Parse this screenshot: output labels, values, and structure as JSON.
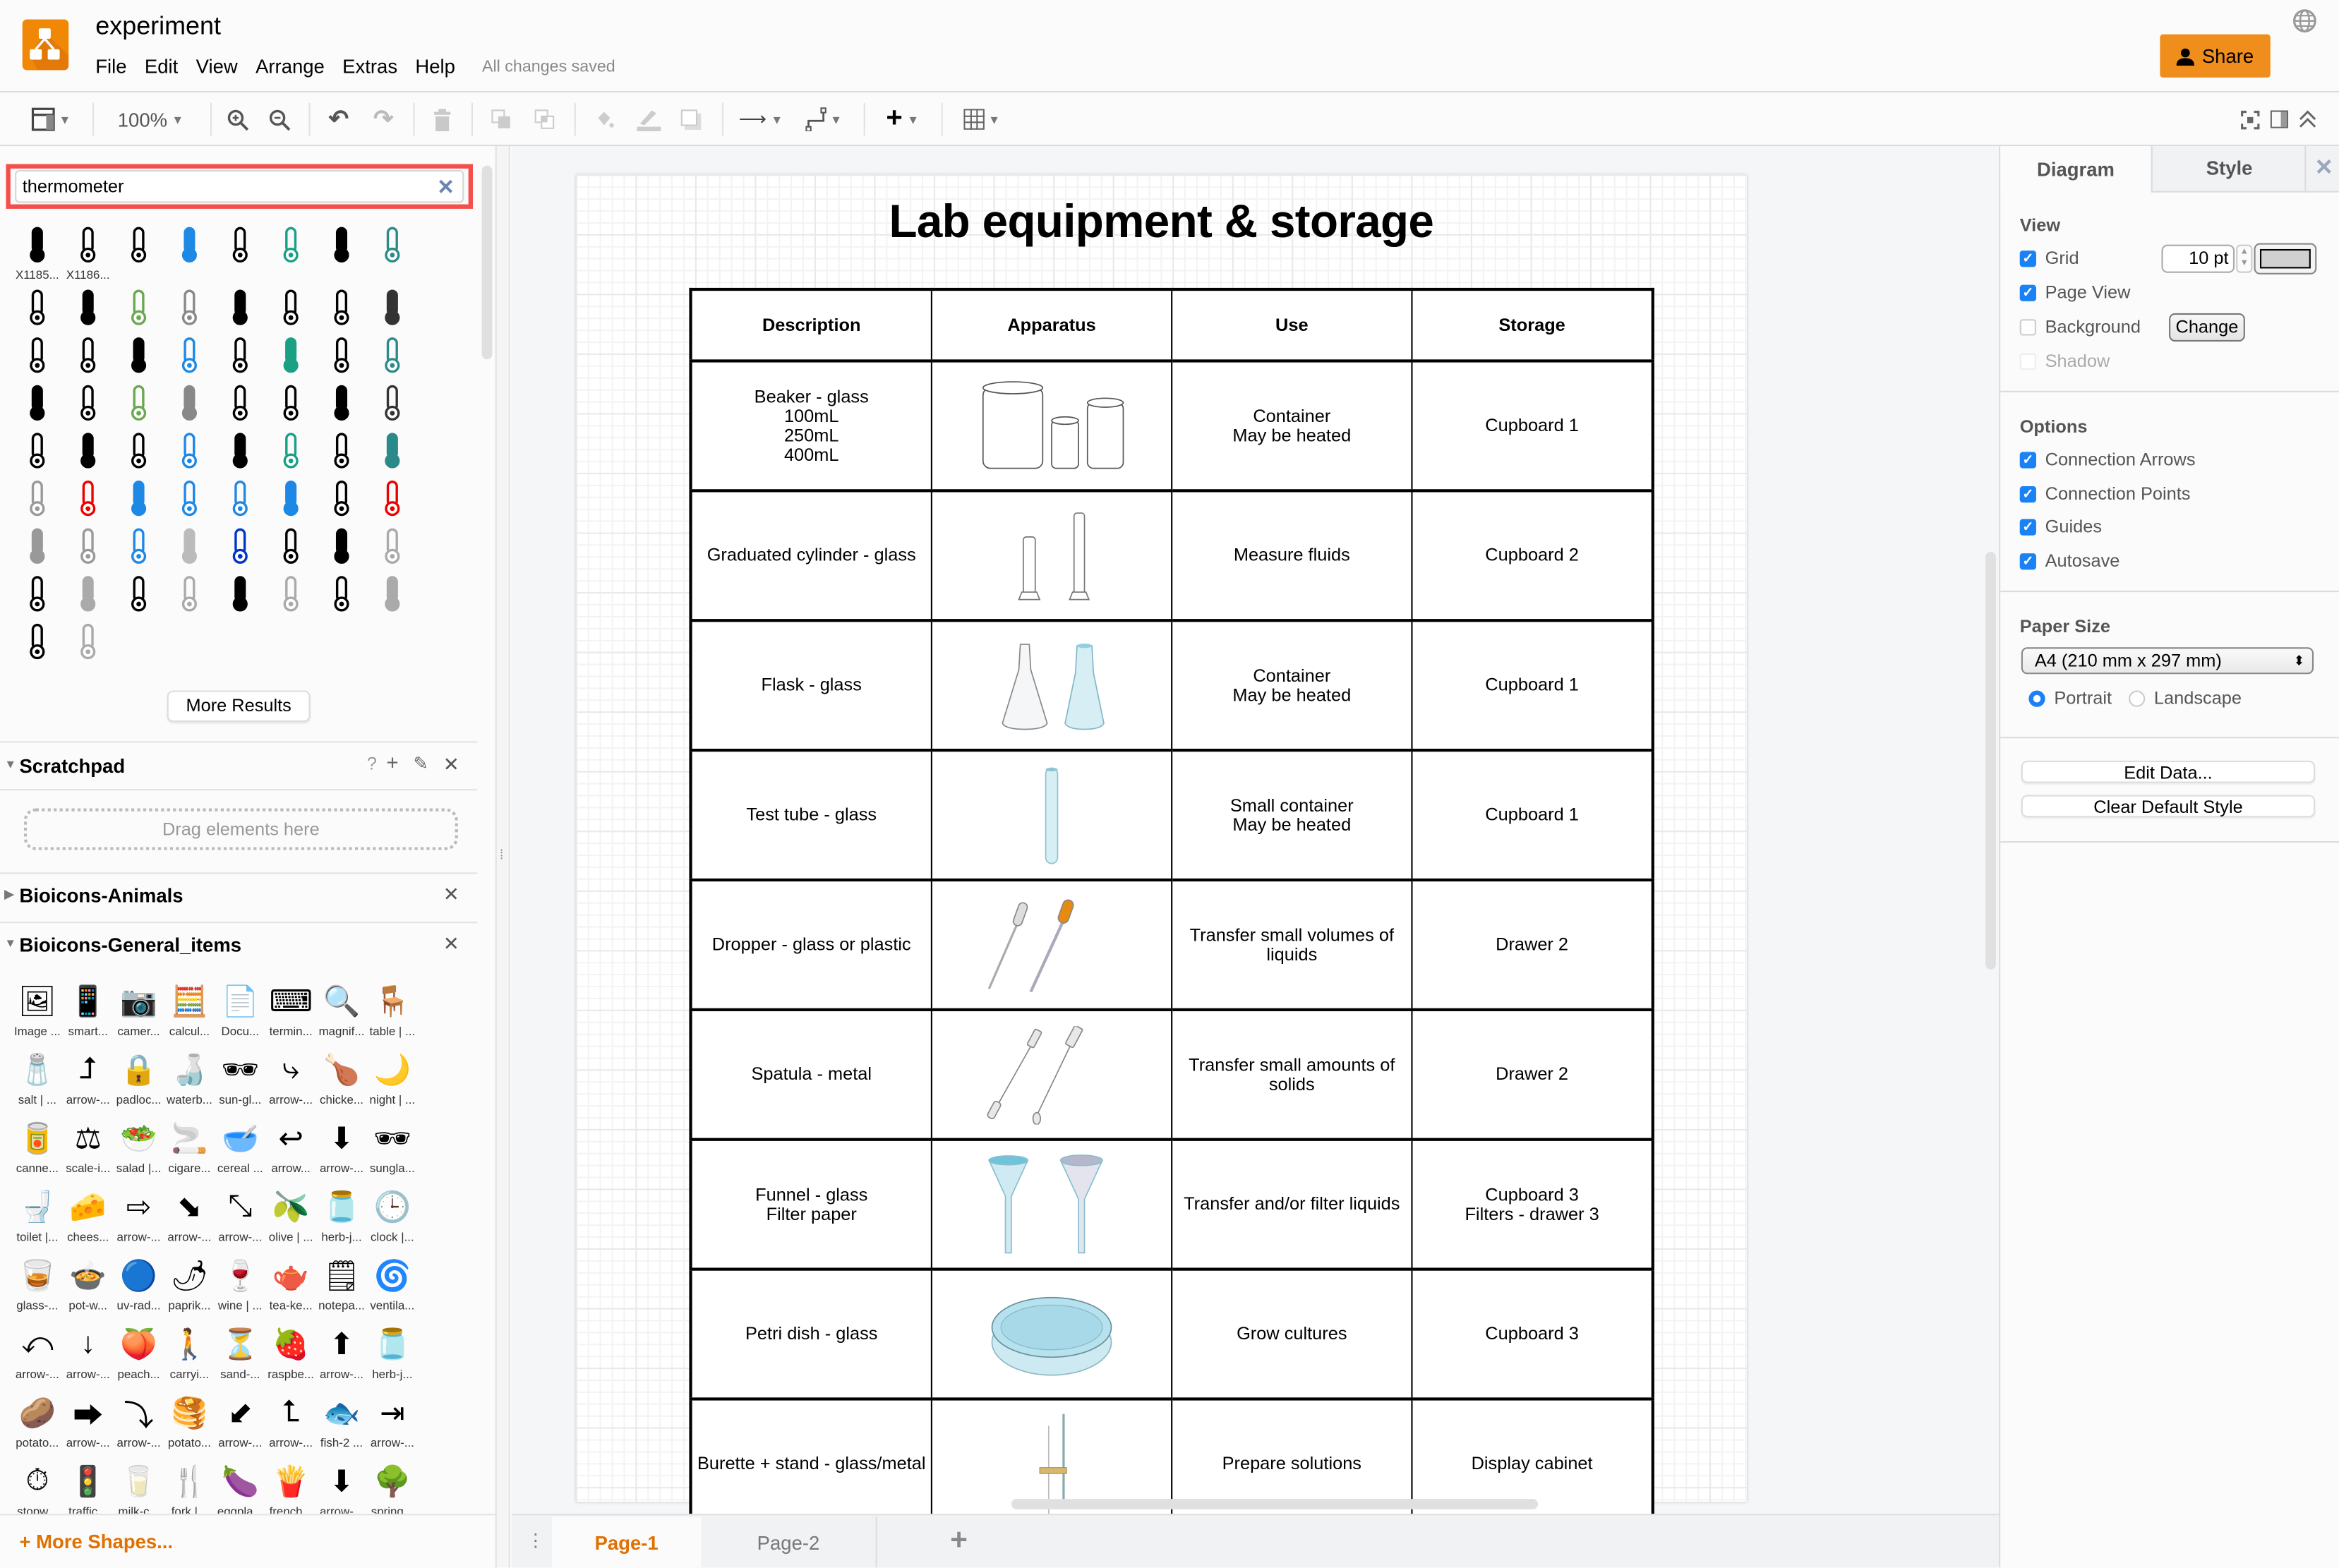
{
  "app": {
    "title": "experiment",
    "status": "All changes saved",
    "share_label": "Share",
    "brand_color": "#f08705",
    "menu": [
      "File",
      "Edit",
      "View",
      "Arrange",
      "Extras",
      "Help"
    ]
  },
  "toolbar": {
    "zoom": "100%",
    "buttons": [
      "format-panel",
      "zoom-in",
      "zoom-out",
      "undo",
      "redo",
      "delete",
      "to-front",
      "to-back",
      "fill-color",
      "line-color",
      "shadow",
      "connection",
      "waypoints",
      "insert",
      "table",
      "fullscreen",
      "toggle-format",
      "collapse"
    ]
  },
  "sidebar": {
    "search": {
      "value": "thermometer",
      "clear_icon": "close-icon"
    },
    "search_results": {
      "labels": [
        "X1185...",
        "X1186..."
      ],
      "count": 66,
      "more_label": "More Results"
    },
    "scratchpad": {
      "title": "Scratchpad",
      "help": "?",
      "placeholder": "Drag elements here"
    },
    "libraries": [
      {
        "title": "Bioicons-Animals",
        "expanded": false
      },
      {
        "title": "Bioicons-General_items",
        "expanded": true
      }
    ],
    "general_items": [
      "Image ...",
      "smart...",
      "camer...",
      "calcul...",
      "Docu...",
      "termin...",
      "magnif...",
      "table | ...",
      "salt | ...",
      "arrow-...",
      "padloc...",
      "waterb...",
      "sun-gl...",
      "arrow-...",
      "chicke...",
      "night | ...",
      "canne...",
      "scale-i...",
      "salad |...",
      "cigare...",
      "cereal ...",
      "arrow...",
      "arrow-...",
      "sungla...",
      "toilet |...",
      "chees...",
      "arrow-...",
      "arrow-...",
      "arrow-...",
      "olive | ...",
      "herb-j...",
      "clock |...",
      "glass-...",
      "pot-w...",
      "uv-rad...",
      "paprik...",
      "wine | ...",
      "tea-ke...",
      "notepa...",
      "ventila...",
      "arrow-...",
      "arrow-...",
      "peach...",
      "carryi...",
      "sand-...",
      "raspbe...",
      "arrow-...",
      "herb-j...",
      "potato...",
      "arrow-...",
      "arrow-...",
      "potato...",
      "arrow-...",
      "arrow-...",
      "fish-2 ...",
      "arrow-...",
      "stopw...",
      "traffic...",
      "milk-c...",
      "fork |...",
      "eggpla...",
      "french...",
      "arrow-...",
      "spring..."
    ],
    "more_shapes": "+ More Shapes..."
  },
  "document": {
    "title": "Lab equipment & storage",
    "columns": [
      "Description",
      "Apparatus",
      "Use",
      "Storage"
    ],
    "rows": [
      {
        "description": [
          "Beaker - glass",
          "100mL",
          "250mL",
          "400mL"
        ],
        "apparatus": "beakers",
        "use": [
          "Container",
          "May be heated"
        ],
        "storage": [
          "Cupboard 1"
        ]
      },
      {
        "description": [
          "Graduated cylinder - glass"
        ],
        "apparatus": "graduated-cylinders",
        "use": [
          "Measure fluids"
        ],
        "storage": [
          "Cupboard 2"
        ]
      },
      {
        "description": [
          "Flask - glass"
        ],
        "apparatus": "flasks",
        "use": [
          "Container",
          "May be heated"
        ],
        "storage": [
          "Cupboard 1"
        ]
      },
      {
        "description": [
          "Test tube - glass"
        ],
        "apparatus": "test-tube",
        "use": [
          "Small container",
          "May be heated"
        ],
        "storage": [
          "Cupboard 1"
        ]
      },
      {
        "description": [
          "Dropper - glass or plastic"
        ],
        "apparatus": "droppers",
        "use": [
          "Transfer small volumes of",
          "liquids"
        ],
        "storage": [
          "Drawer 2"
        ]
      },
      {
        "description": [
          "Spatula - metal"
        ],
        "apparatus": "spatulas",
        "use": [
          "Transfer small amounts of",
          "solids"
        ],
        "storage": [
          "Drawer 2"
        ]
      },
      {
        "description": [
          "Funnel - glass",
          "Filter paper"
        ],
        "apparatus": "funnels",
        "use": [
          "Transfer and/or filter liquids"
        ],
        "storage": [
          "Cupboard 3",
          "Filters - drawer 3"
        ]
      },
      {
        "description": [
          "Petri dish - glass"
        ],
        "apparatus": "petri-dish",
        "use": [
          "Grow cultures"
        ],
        "storage": [
          "Cupboard 3"
        ]
      },
      {
        "description": [
          "Burette + stand - glass/metal"
        ],
        "apparatus": "burette",
        "use": [
          "Prepare solutions"
        ],
        "storage": [
          "Display cabinet"
        ]
      }
    ]
  },
  "pages": {
    "tabs": [
      "Page-1",
      "Page-2"
    ],
    "active": "Page-1",
    "active_color": "#e07100"
  },
  "format_panel": {
    "tabs": [
      "Diagram",
      "Style"
    ],
    "view": {
      "title": "View",
      "grid": {
        "label": "Grid",
        "checked": true,
        "size": "10 pt",
        "color": "#d0d0d0"
      },
      "page_view": {
        "label": "Page View",
        "checked": true
      },
      "background": {
        "label": "Background",
        "checked": false,
        "button": "Change"
      },
      "shadow": {
        "label": "Shadow",
        "checked": false,
        "disabled": true
      }
    },
    "options": {
      "title": "Options",
      "items": [
        {
          "label": "Connection Arrows",
          "checked": true
        },
        {
          "label": "Connection Points",
          "checked": true
        },
        {
          "label": "Guides",
          "checked": true
        },
        {
          "label": "Autosave",
          "checked": true
        }
      ]
    },
    "paper_size": {
      "title": "Paper Size",
      "value": "A4 (210 mm x 297 mm)",
      "orientation": [
        "Portrait",
        "Landscape"
      ],
      "selected": "Portrait"
    },
    "buttons": [
      "Edit Data...",
      "Clear Default Style"
    ]
  }
}
